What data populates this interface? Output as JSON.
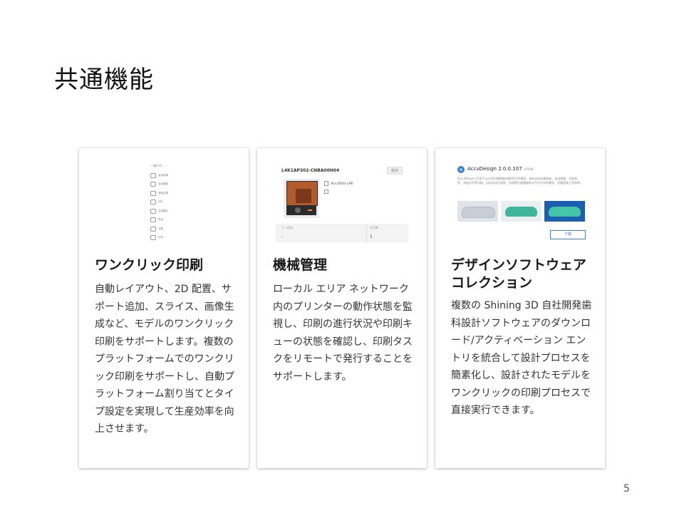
{
  "slide": {
    "title": "共通機能",
    "page_number": "5"
  },
  "cards": [
    {
      "title": "ワンクリック印刷",
      "body": "自動レイアウト、2D 配置、サポート追加、スライス、画像生成など、モデルのワンクリック印刷をサポートします。複数のプラットフォームでのワンクリック印刷をサポートし、自動プラットフォーム割り当てとタイプ設定を実現して生産効率を向上させます。",
      "screenshot": {
        "header": "一键打印 ⌄",
        "menu_items": [
          {
            "icon": "circle-icon",
            "label": "自动布局"
          },
          {
            "icon": "grid-icon",
            "label": "自动摆放"
          },
          {
            "icon": "support-icon",
            "label": "添加支撑"
          },
          {
            "icon": "slice-icon",
            "label": "切片"
          },
          {
            "icon": "cloud-icon",
            "label": "生成图片"
          },
          {
            "icon": "export-icon",
            "label": "导出"
          },
          {
            "icon": "chevron-icon",
            "label": "分配"
          },
          {
            "icon": "print-icon",
            "label": "打印"
          }
        ]
      }
    },
    {
      "title": "機械管理",
      "body": "ローカル エリア ネットワーク内のプリンターの動作状態を監視し、印刷の進行状況や印刷キューの状態を確認し、印刷タスクをリモートで発行することをサポートします。",
      "screenshot": {
        "serial": "L4K1AP302-CNBA00H04",
        "status_tag": "離線",
        "model": "AccuFab-L4K",
        "stat1_label": "下一任务",
        "stat1_value": "-",
        "stat2_label": "队列数",
        "stat2_value": "1"
      }
    },
    {
      "title": "デザインソフトウェアコレクション",
      "body": "複数の Shining 3D 自社開発歯科設計ソフトウェアのダウンロード/アクティベーション エントリを統合して設計プロセスを簡素化し、設計されたモデルをワンクリックの印刷プロセスで直接実行できます。",
      "screenshot": {
        "app_name": "AccuDesign 2.0.0.107",
        "app_size": "340MB",
        "description": "AccuDesign+可用于从口内扫描数据创建3D打印模型。具有自动创建底座、自动修复、添加标签、添加文字等功能；自动化设计流程，快速将扫描数据转化为可打印的模型，显著提高工作效率。",
        "download_label": "下载"
      }
    }
  ]
}
